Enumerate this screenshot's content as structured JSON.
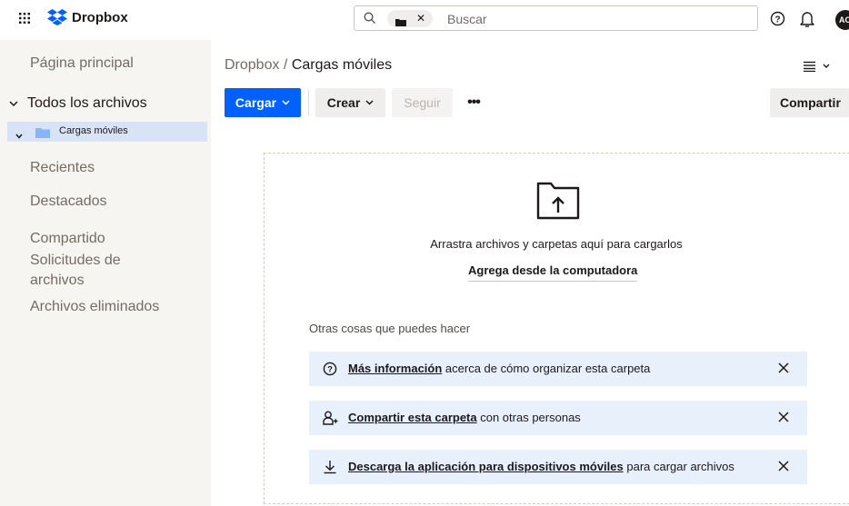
{
  "header": {
    "logo_text": "Dropbox",
    "search_placeholder": "Buscar",
    "avatar_initials": "AC",
    "brand_color": "#0061fe"
  },
  "sidebar": {
    "home": "Página principal",
    "all_files": "Todos los archivos",
    "selected_folder": "Cargas móviles",
    "recent": "Recientes",
    "starred": "Destacados",
    "shared": "Compartido",
    "file_requests": "Solicitudes de archivos",
    "deleted": "Archivos eliminados"
  },
  "breadcrumb": {
    "root": "Dropbox",
    "separator": " / ",
    "current": "Cargas móviles"
  },
  "toolbar": {
    "upload": "Cargar",
    "create": "Crear",
    "follow": "Seguir",
    "more": "•••",
    "share": "Compartir"
  },
  "dropzone": {
    "drag_text": "Arrastra archivos y carpetas aquí para cargarlos",
    "add_link": "Agrega desde la computadora"
  },
  "suggestions": {
    "title": "Otras cosas que puedes hacer",
    "items": [
      {
        "icon": "help-icon",
        "link": "Más información",
        "text": " acerca de cómo organizar esta carpeta"
      },
      {
        "icon": "share-person-icon",
        "link": "Compartir esta carpeta",
        "text": " con otras personas"
      },
      {
        "icon": "download-icon",
        "link": "Descarga la aplicación para dispositivos móviles",
        "text": " para cargar archivos"
      }
    ]
  }
}
